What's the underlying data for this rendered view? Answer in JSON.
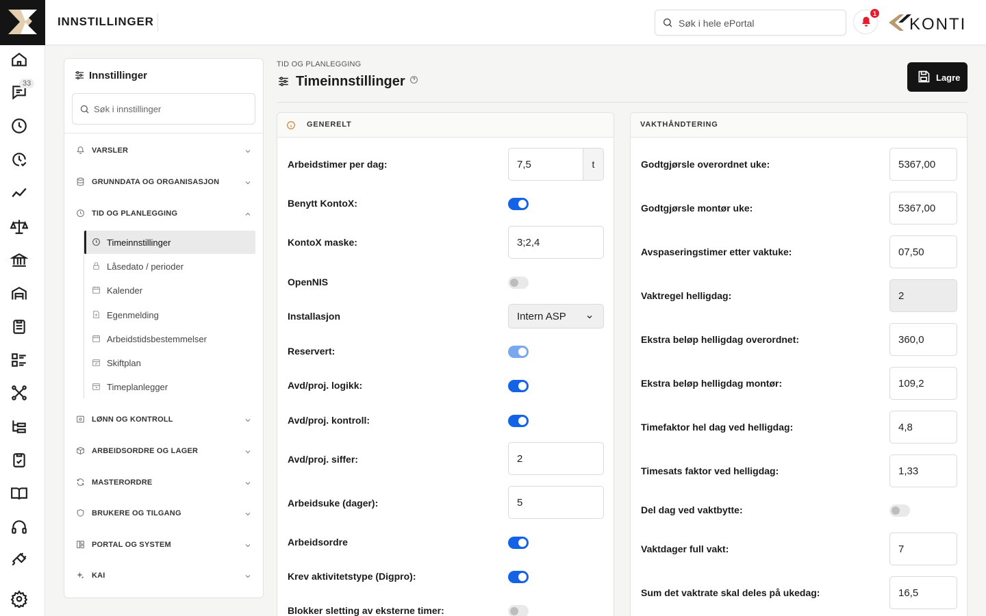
{
  "app": {
    "title": "INNSTILLINGER",
    "brand": "KONTI",
    "notifications": "1"
  },
  "search": {
    "placeholder": "Søk i hele ePortal"
  },
  "rail": {
    "messages_badge": "33"
  },
  "sidebar": {
    "heading": "Innstillinger",
    "search_placeholder": "Søk i innstillinger",
    "sections": {
      "varsler": "VARSLER",
      "grunndata": "GRUNNDATA OG ORGANISASJON",
      "tid": "TID OG PLANLEGGING",
      "lonn": "LØNN OG KONTROLL",
      "arbeidsordre": "ARBEIDSORDRE OG LAGER",
      "masterordre": "MASTERORDRE",
      "brukere": "BRUKERE OG TILGANG",
      "portal": "PORTAL OG SYSTEM",
      "kai": "KAI"
    },
    "sub_items": {
      "timeinnstillinger": "Timeinnstillinger",
      "lasedato": "Låsedato / perioder",
      "kalender": "Kalender",
      "egenmelding": "Egenmelding",
      "arbeidstid": "Arbeidstidsbestemmelser",
      "skiftplan": "Skiftplan",
      "timeplanlegger": "Timeplanlegger"
    }
  },
  "page": {
    "breadcrumb": "TID OG PLANLEGGING",
    "title": "Timeinnstillinger",
    "save_label": "Lagre"
  },
  "generelt": {
    "heading": "GENERELT",
    "arbeidstimer": {
      "label": "Arbeidstimer per dag:",
      "value": "7,5",
      "unit": "t"
    },
    "kontox": {
      "label": "Benytt KontoX:",
      "on": true
    },
    "maske": {
      "label": "KontoX maske:",
      "value": "3;2,4"
    },
    "opennis": {
      "label": "OpenNIS",
      "on": false
    },
    "installasjon": {
      "label": "Installasjon",
      "value": "Intern ASP"
    },
    "reservert": {
      "label": "Reservert:",
      "on": true
    },
    "logikk": {
      "label": "Avd/proj. logikk:",
      "on": true
    },
    "kontroll": {
      "label": "Avd/proj. kontroll:",
      "on": true
    },
    "siffer": {
      "label": "Avd/proj. siffer:",
      "value": "2"
    },
    "arbeidsuke": {
      "label": "Arbeidsuke (dager):",
      "value": "5"
    },
    "arbeidsordre": {
      "label": "Arbeidsordre",
      "on": true
    },
    "aktivitetstype": {
      "label": "Krev aktivitetstype (Digpro):",
      "on": true
    },
    "blokker": {
      "label": "Blokker sletting av eksterne timer:",
      "on": false
    }
  },
  "vakt": {
    "heading": "VAKTHÅNDTERING",
    "godt_over": {
      "label": "Godtgjørsle overordnet uke:",
      "value": "5367,00"
    },
    "godt_mont": {
      "label": "Godtgjørsle montør uke:",
      "value": "5367,00"
    },
    "avspasering": {
      "label": "Avspaseringstimer etter vaktuke:",
      "value": "07,50"
    },
    "vaktregel": {
      "label": "Vaktregel helligdag:",
      "value": "2"
    },
    "ekstra_over": {
      "label": "Ekstra beløp helligdag overordnet:",
      "value": "360,0"
    },
    "ekstra_mont": {
      "label": "Ekstra beløp helligdag montør:",
      "value": "109,2"
    },
    "timefaktor": {
      "label": "Timefaktor hel dag ved helligdag:",
      "value": "4,8"
    },
    "timesats": {
      "label": "Timesats faktor ved helligdag:",
      "value": "1,33"
    },
    "del_dag": {
      "label": "Del dag ved vaktbytte:",
      "on": false
    },
    "vaktdager": {
      "label": "Vaktdager full vakt:",
      "value": "7"
    },
    "sum_vakt": {
      "label": "Sum det vaktrate skal deles på ukedag:",
      "value": "16,5"
    }
  }
}
